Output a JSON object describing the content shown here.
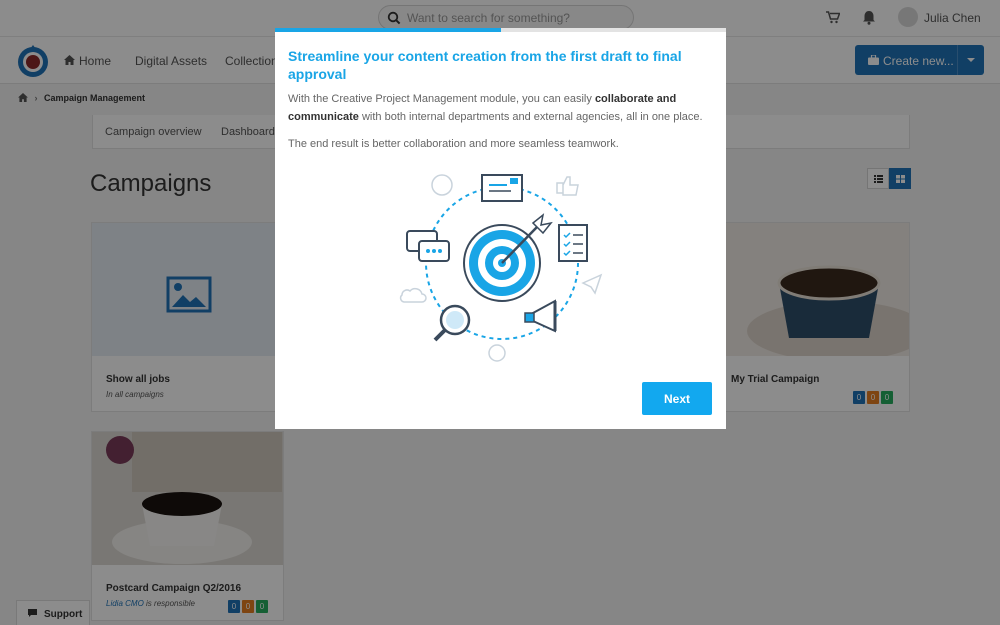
{
  "search": {
    "placeholder": "Want to search for something?"
  },
  "user": {
    "name": "Julia Chen"
  },
  "nav": {
    "items": [
      "Home",
      "Digital Assets",
      "Collections"
    ],
    "create_label": "Create new..."
  },
  "breadcrumb": {
    "current": "Campaign Management"
  },
  "subtabs": [
    "Campaign overview",
    "Dashboard"
  ],
  "page": {
    "title": "Campaigns"
  },
  "cards": [
    {
      "title": "Show all jobs",
      "sub": "In all campaigns"
    },
    {
      "title": "My Trial Campaign",
      "badges": [
        "0",
        "0",
        "0"
      ]
    },
    {
      "title": "Postcard Campaign Q2/2016",
      "responsible_name": "Lidia CMO",
      "responsible_suffix": "is responsible",
      "badges": [
        "0",
        "0",
        "0"
      ]
    }
  ],
  "support": {
    "label": "Support"
  },
  "modal": {
    "title": "Streamline your content creation from the first draft to final approval",
    "text_pre": "With the Creative Project Management module, you can easily ",
    "text_bold": "collaborate and communicate",
    "text_post": " with both internal departments and external agencies, all in one place.",
    "text2": "The end result is better collaboration and more seamless teamwork.",
    "next_label": "Next",
    "progress_fraction": 0.5
  },
  "colors": {
    "accent": "#19a5e6",
    "brand_blue": "#1f73b8"
  }
}
